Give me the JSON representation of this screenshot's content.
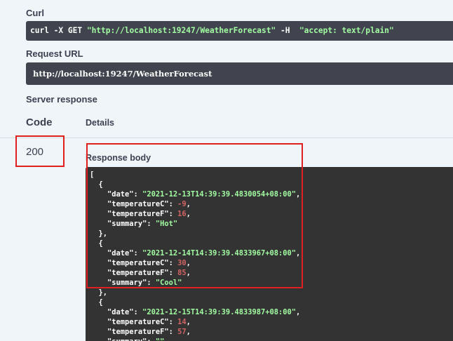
{
  "curl": {
    "label": "Curl",
    "command_prefix": "curl -X GET ",
    "url_quoted": "\"http://localhost:19247/WeatherForecast\"",
    "header_flag": " -H  ",
    "header_value": "\"accept: text/plain\""
  },
  "request_url": {
    "label": "Request URL",
    "value": "http://localhost:19247/WeatherForecast"
  },
  "server_response": {
    "label": "Server response",
    "code_header": "Code",
    "details_header": "Details",
    "status_code": "200",
    "response_body_label": "Response body"
  },
  "response_json": {
    "open_bracket": "[",
    "items": [
      {
        "date": "2021-12-13T14:39:39.4830054+08:00",
        "temperatureC": "-9",
        "temperatureF": "16",
        "summary": "Hot"
      },
      {
        "date": "2021-12-14T14:39:39.4833967+08:00",
        "temperatureC": "30",
        "temperatureF": "85",
        "summary": "Cool"
      },
      {
        "date": "2021-12-15T14:39:39.4833987+08:00",
        "temperatureC": "14",
        "temperatureF": "57",
        "summary": ""
      }
    ]
  },
  "colors": {
    "highlight": "#e02020",
    "string": "#a2fca2",
    "number": "#d36363",
    "code_bg": "#41444e",
    "response_bg": "#333333"
  }
}
